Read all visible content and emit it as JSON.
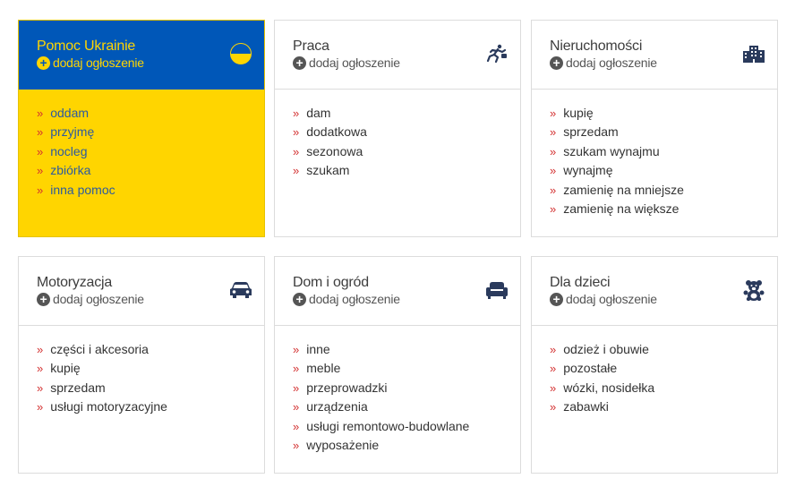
{
  "colors": {
    "ukraine_blue": "#0057b8",
    "ukraine_yellow": "#ffd500",
    "bullet_red": "#d32f2f",
    "icon_navy": "#2a3a5c"
  },
  "bullet": "»",
  "categories": [
    {
      "title": "Pomoc Ukrainie",
      "add_label": "dodaj ogłoszenie",
      "icon": "ukraine-flag-icon",
      "items": [
        "oddam",
        "przyjmę",
        "nocleg",
        "zbiórka",
        "inna pomoc"
      ]
    },
    {
      "title": "Praca",
      "add_label": "dodaj ogłoszenie",
      "icon": "running-man-icon",
      "items": [
        "dam",
        "dodatkowa",
        "sezonowa",
        "szukam"
      ]
    },
    {
      "title": "Nieruchomości",
      "add_label": "dodaj ogłoszenie",
      "icon": "buildings-icon",
      "items": [
        "kupię",
        "sprzedam",
        "szukam wynajmu",
        "wynajmę",
        "zamienię na mniejsze",
        "zamienię na większe"
      ]
    },
    {
      "title": "Motoryzacja",
      "add_label": "dodaj ogłoszenie",
      "icon": "car-icon",
      "items": [
        "części i akcesoria",
        "kupię",
        "sprzedam",
        "usługi motoryzacyjne"
      ]
    },
    {
      "title": "Dom i ogród",
      "add_label": "dodaj ogłoszenie",
      "icon": "armchair-icon",
      "items": [
        "inne",
        "meble",
        "przeprowadzki",
        "urządzenia",
        "usługi remontowo-budowlane",
        "wyposażenie"
      ]
    },
    {
      "title": "Dla dzieci",
      "add_label": "dodaj ogłoszenie",
      "icon": "teddy-bear-icon",
      "items": [
        "odzież i obuwie",
        "pozostałe",
        "wózki, nosidełka",
        "zabawki"
      ]
    }
  ]
}
